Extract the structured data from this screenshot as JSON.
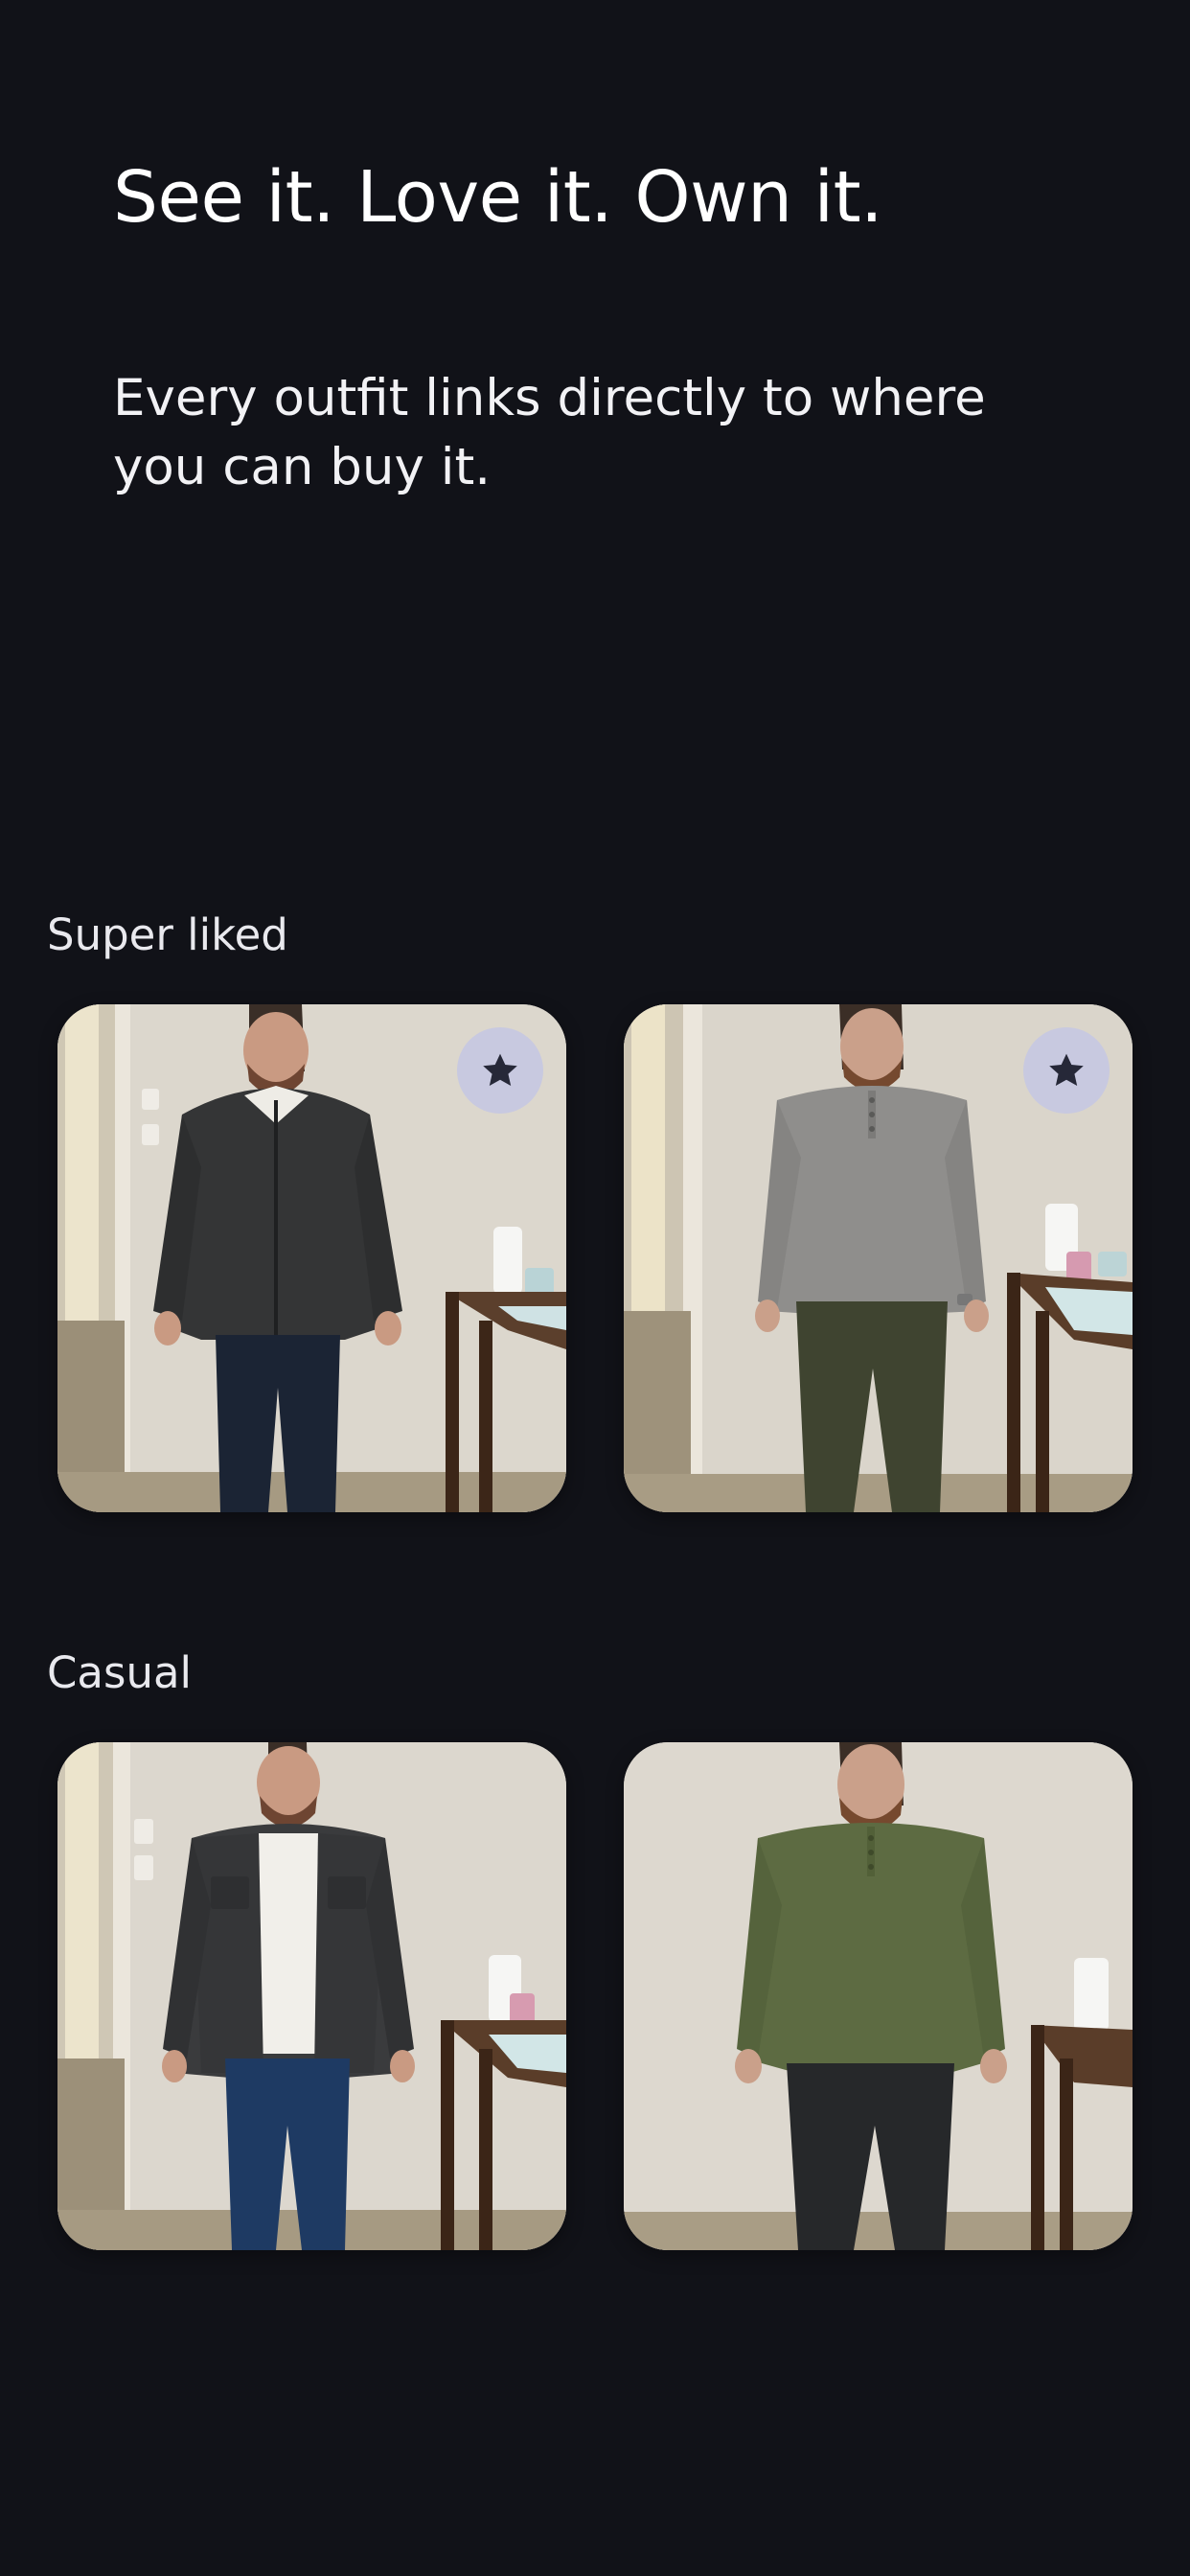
{
  "onboarding": {
    "headline": "See it. Love it. Own it.",
    "subhead": "Every outfit links directly to where you can buy it."
  },
  "sections": [
    {
      "label": "Super liked",
      "items": [
        {
          "photo": "outfit-charcoal-fleece-jacket-dark-jeans",
          "badge_icon": "star-icon",
          "badge_color": "#c8c9e0"
        },
        {
          "photo": "outfit-grey-henley-olive-pants",
          "badge_icon": "star-icon",
          "badge_color": "#c8c9e0"
        }
      ]
    },
    {
      "label": "Casual",
      "items": [
        {
          "photo": "outfit-charcoal-overshirt-white-tee-blue-jeans"
        },
        {
          "photo": "outfit-olive-henley-black-pants"
        }
      ]
    }
  ],
  "colors": {
    "background": "#111218",
    "text_primary": "#ffffff",
    "star_badge": "#c8c9e0",
    "star": "#262838"
  }
}
